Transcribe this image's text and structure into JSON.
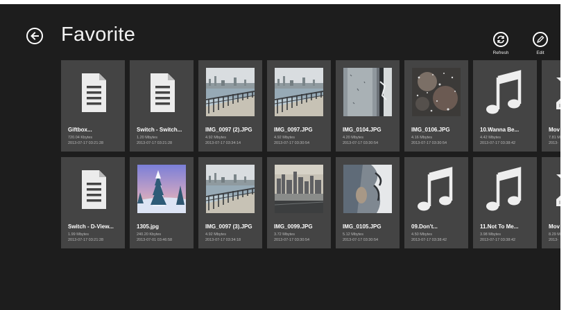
{
  "header": {
    "title": "Favorite"
  },
  "appbar": {
    "refresh_label": "Refresh",
    "edit_label": "Edit"
  },
  "rows": [
    [
      {
        "icon": "document-icon",
        "name": "Giftbox...",
        "size": "720.04 Kbytes",
        "date": "2013-07-17 03:21:28"
      },
      {
        "icon": "document-icon",
        "name": "Switch - Switch...",
        "size": "1.20 Mbytes",
        "date": "2013-07-17 03:21:28"
      },
      {
        "icon": "photo-thumbnail",
        "name": "IMG_0097 (2).JPG",
        "size": "4.92 Mbytes",
        "date": "2013-07-17 03:34:14"
      },
      {
        "icon": "photo-thumbnail",
        "name": "IMG_0097.JPG",
        "size": "4.92 Mbytes",
        "date": "2013-07-17 03:30:54"
      },
      {
        "icon": "photo-thumbnail",
        "name": "IMG_0104.JPG",
        "size": "4.20 Mbytes",
        "date": "2013-07-17 03:30:54"
      },
      {
        "icon": "photo-thumbnail",
        "name": "IMG_0106.JPG",
        "size": "4.16 Mbytes",
        "date": "2013-07-17 03:30:54"
      },
      {
        "icon": "music-note-icon",
        "name": "10.Wanna Be...",
        "size": "4.42 Mbytes",
        "date": "2013-07-17 03:38:42"
      },
      {
        "icon": "video-icon",
        "name": "Mov",
        "size": "7.81 M",
        "date": "2013-"
      }
    ],
    [
      {
        "icon": "document-icon",
        "name": "Switch - D-View...",
        "size": "1.99 Mbytes",
        "date": "2013-07-17 03:21:28"
      },
      {
        "icon": "photo-thumbnail",
        "name": "1305.jpg",
        "size": "240.20 Kbytes",
        "date": "2013-07-01 03:46:58"
      },
      {
        "icon": "photo-thumbnail",
        "name": "IMG_0097 (3).JPG",
        "size": "4.92 Mbytes",
        "date": "2013-07-17 03:34:18"
      },
      {
        "icon": "photo-thumbnail",
        "name": "IMG_0099.JPG",
        "size": "3.72 Mbytes",
        "date": "2013-07-17 03:30:54"
      },
      {
        "icon": "photo-thumbnail",
        "name": "IMG_0105.JPG",
        "size": "5.12 Mbytes",
        "date": "2013-07-17 03:30:54"
      },
      {
        "icon": "music-note-icon",
        "name": "09.Don't...",
        "size": "4.50 Mbytes",
        "date": "2013-07-17 03:38:42"
      },
      {
        "icon": "music-note-icon",
        "name": "11.Not To Me...",
        "size": "3.98 Mbytes",
        "date": "2013-07-17 03:38:42"
      },
      {
        "icon": "video-icon",
        "name": "Mov",
        "size": "8.29 M",
        "date": "2013-"
      }
    ]
  ]
}
